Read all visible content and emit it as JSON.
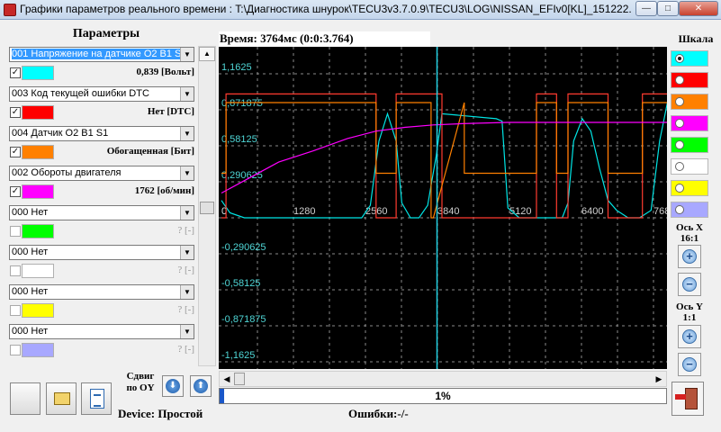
{
  "window": {
    "title": "Графики параметров реального времени : T:\\Диагностика шнурок\\TECU3v3.7.0.9\\TECU3\\LOG\\NISSAN_EFIv0[KL]_151222..."
  },
  "params": {
    "title": "Параметры",
    "rows": [
      {
        "select": "001 Напряжение на датчике O2 B1 S1",
        "checked": true,
        "color": "#00ffff",
        "value": "0,839 [Вольт]",
        "dim": false
      },
      {
        "select": "003 Код текущей ошибки DTC",
        "checked": true,
        "color": "#ff0000",
        "value": "Нет [DTC]",
        "dim": false
      },
      {
        "select": "004 Датчик O2 B1 S1",
        "checked": true,
        "color": "#ff8000",
        "value": "Обогащенная [Бит]",
        "dim": false
      },
      {
        "select": "002 Обороты двигателя",
        "checked": true,
        "color": "#ff00ff",
        "value": "1762 [об/мин]",
        "dim": false
      },
      {
        "select": "000 Нет",
        "checked": false,
        "color": "#00ff00",
        "value": "? [-]",
        "dim": true
      },
      {
        "select": "000 Нет",
        "checked": false,
        "color": "#ffffff",
        "value": "? [-]",
        "dim": true
      },
      {
        "select": "000 Нет",
        "checked": false,
        "color": "#ffff00",
        "value": "? [-]",
        "dim": true
      },
      {
        "select": "000 Нет",
        "checked": false,
        "color": "#a8a8ff",
        "value": "? [-]",
        "dim": true
      }
    ]
  },
  "chart_data": {
    "type": "line",
    "title": "Время: 3764мс (0:0:3.764)",
    "x_ticks": [
      "0",
      "1280",
      "2560",
      "3840",
      "5120",
      "6400",
      "768"
    ],
    "y_ticks": [
      "1,1625",
      "0,871875",
      "0,58125",
      "0,290625",
      "0",
      "-0,290625",
      "-0,58125",
      "-0,871875",
      "-1,1625"
    ],
    "xlim": [
      0,
      7936
    ],
    "ylim": [
      -1.1625,
      1.1625
    ],
    "grid": true,
    "cursor_x": 3764,
    "series": [
      {
        "color": "#00e5e5",
        "x": [
          0,
          150,
          400,
          800,
          1600,
          2100,
          2450,
          2600,
          2750,
          2900,
          3050,
          3150,
          3300,
          3450,
          3600,
          3750,
          3850,
          4800,
          4900,
          5000,
          5200,
          5500,
          5800,
          5950,
          6050,
          6150,
          6300,
          6450,
          6600,
          6750,
          6900,
          7100,
          7300,
          7500,
          7650,
          7800,
          7936
        ],
        "y": [
          0.14,
          0.04,
          0.0,
          0.0,
          0.0,
          0.0,
          0.0,
          0.1,
          0.62,
          0.84,
          0.62,
          0.12,
          0.0,
          0.0,
          0.1,
          0.5,
          0.84,
          0.8,
          0.78,
          0.08,
          0.0,
          0.0,
          0.0,
          0.0,
          0.12,
          0.62,
          0.8,
          0.7,
          0.4,
          0.14,
          0.06,
          0.0,
          0.0,
          0.06,
          0.62,
          0.96,
          0.96
        ]
      },
      {
        "color": "#ff3b2f",
        "x": [
          0,
          80,
          80,
          2700,
          2700,
          3050,
          3050,
          3850,
          3850,
          5500,
          5500,
          5850,
          5850,
          6050,
          6050,
          6750,
          6750,
          7350,
          7350,
          7936
        ],
        "y": [
          0.0,
          0.0,
          1.0,
          1.0,
          0.0,
          0.0,
          1.0,
          1.0,
          0.0,
          0.0,
          1.0,
          1.0,
          0.0,
          0.0,
          1.0,
          1.0,
          0.0,
          0.0,
          1.0,
          1.0
        ]
      },
      {
        "color": "#ff8000",
        "x": [
          0,
          80,
          80,
          2700,
          2700,
          3050,
          3050,
          3660,
          3660,
          3700,
          3700,
          4240,
          4240,
          5500,
          5500,
          5850,
          5850,
          6050,
          6050,
          6750,
          6750,
          7350,
          7350,
          7936
        ],
        "y": [
          0.36,
          0.36,
          0.93,
          0.93,
          0.36,
          0.36,
          0.93,
          0.93,
          0.0,
          0.0,
          0.0,
          0.93,
          0.36,
          0.36,
          0.93,
          0.93,
          0.36,
          0.36,
          0.93,
          0.93,
          0.36,
          0.36,
          0.93,
          0.93
        ]
      },
      {
        "color": "#ff00ff",
        "x": [
          0,
          400,
          1000,
          1600,
          2200,
          2700,
          3200,
          3700,
          4200,
          5000,
          6000,
          7000,
          7936
        ],
        "y": [
          0.2,
          0.3,
          0.45,
          0.54,
          0.64,
          0.7,
          0.73,
          0.75,
          0.76,
          0.77,
          0.77,
          0.77,
          0.77
        ]
      }
    ]
  },
  "shift": {
    "label_line1": "Сдвиг",
    "label_line2": "по OY"
  },
  "progress": {
    "value": 0.01,
    "label": "1%"
  },
  "scale": {
    "title": "Шкала",
    "colors": [
      "#00ffff",
      "#ff0000",
      "#ff8000",
      "#ff00ff",
      "#00ff00",
      "#ffffff",
      "#ffff00",
      "#a8a8ff"
    ],
    "selected": 0,
    "axis_x_title": "Ось X",
    "axis_x_ratio": "16:1",
    "axis_y_title": "Ось Y",
    "axis_y_ratio": "1:1"
  },
  "status": {
    "device": "Device:  Простой",
    "errors": "Ошибки:-/-"
  },
  "icons": {
    "dropdown": "▼",
    "scroll_up": "▲",
    "scroll_left": "◀",
    "scroll_right": "▶",
    "check": "✓",
    "plus": "+",
    "minus": "−",
    "shift_down": "⬇",
    "shift_up": "⬆",
    "minimize": "—",
    "maximize": "□",
    "close": "✕"
  }
}
